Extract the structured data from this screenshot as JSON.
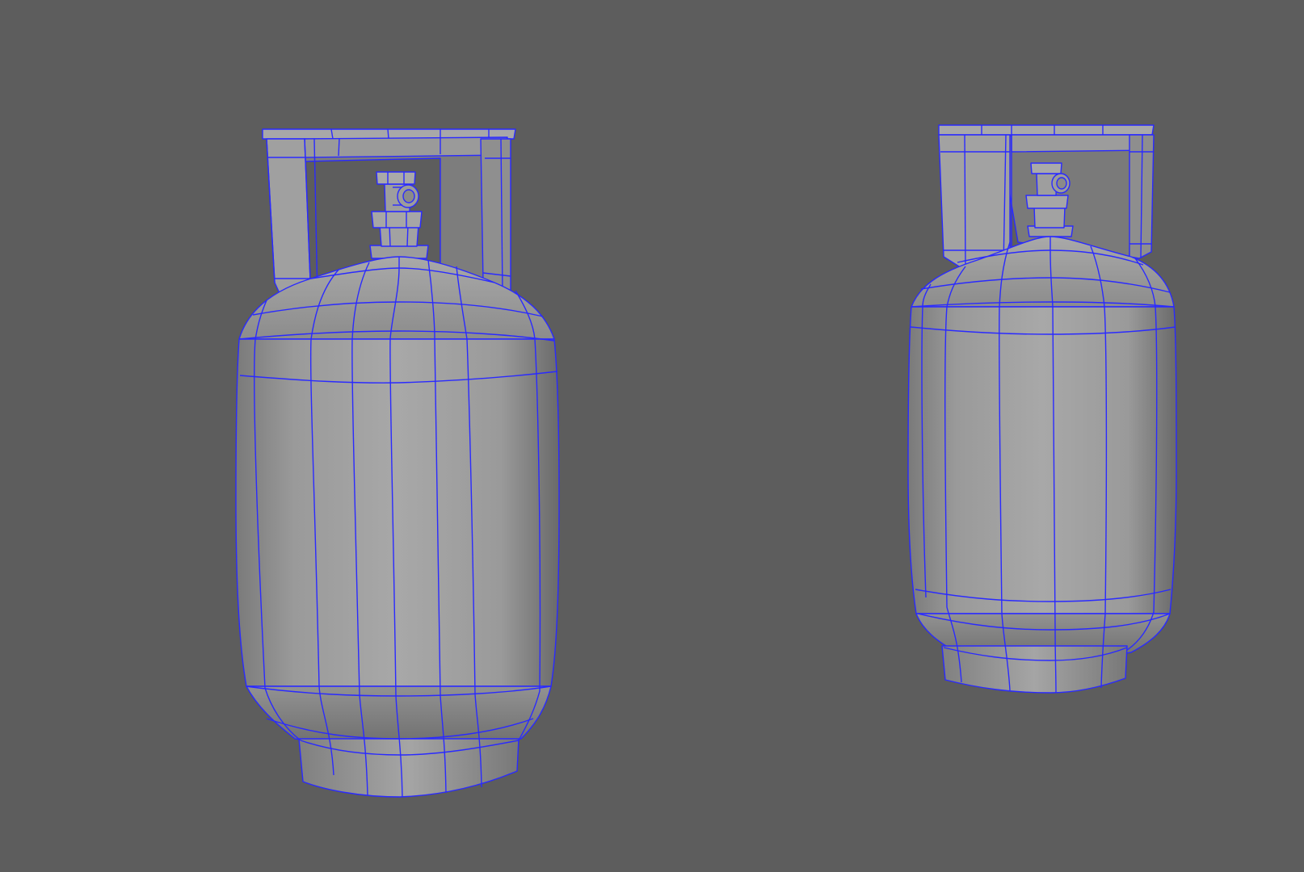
{
  "colors": {
    "background": "#5d5d5d",
    "wireframe": "#2a2aff",
    "mesh_light": "#a6a6a6",
    "mesh_mid": "#8f8f8f",
    "mesh_dark": "#6c6c6c"
  },
  "objects": [
    {
      "type": "gas-cylinder",
      "render": "shaded-wireframe"
    },
    {
      "type": "gas-cylinder",
      "render": "shaded-wireframe"
    }
  ]
}
